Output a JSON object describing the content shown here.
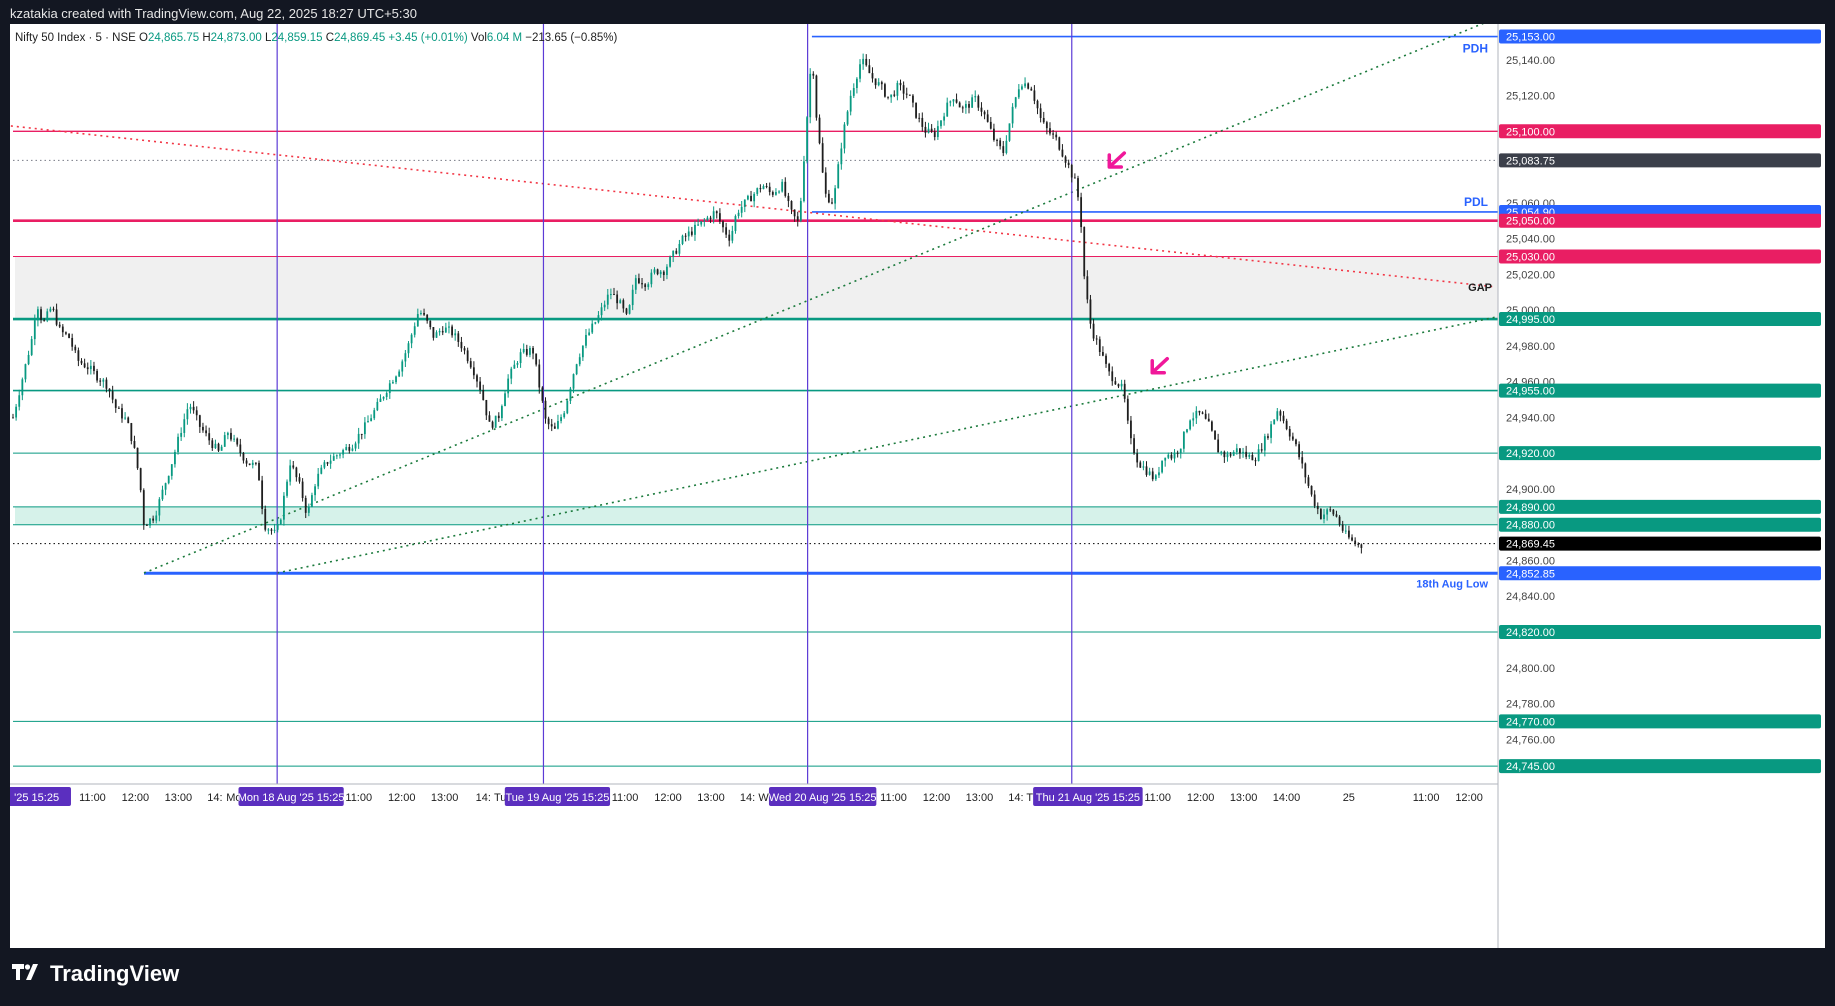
{
  "header": {
    "creator_line": "kzatakia created with TradingView.com, Aug 22, 2025 18:27 UTC+5:30"
  },
  "legend": {
    "symbol": "Nifty 50 Index · 5 · NSE",
    "o_label": "O",
    "o_value": "24,865.75",
    "h_label": "H",
    "h_value": "24,873.00",
    "l_label": "L",
    "l_value": "24,859.15",
    "c_label": "C",
    "c_value": "24,869.45",
    "change": "+3.45 (+0.01%)",
    "vol_label": "Vol",
    "vol_value": "6.04 M",
    "session_change": "−213.65 (−0.85%)"
  },
  "footer": {
    "brand": "TradingView",
    "logo_icon": "tradingview-logo-icon"
  },
  "chart_data": {
    "type": "candlestick",
    "symbol": "Nifty 50 Index",
    "interval": "5",
    "exchange": "NSE",
    "currency": "INR",
    "ylim": [
      24735,
      25160
    ],
    "y_ticks": [
      "25,140.00",
      "25,120.00",
      "25,060.00",
      "25,040.00",
      "25,020.00",
      "25,000.00",
      "24,980.00",
      "24,960.00",
      "24,940.00",
      "24,900.00",
      "24,860.00",
      "24,840.00",
      "24,800.00",
      "24,780.00",
      "24,760.00"
    ],
    "x_tick_labels": [
      {
        "label": "'25",
        "x": 0.15
      },
      {
        "label": "15:25",
        "x": 1.0
      },
      {
        "label": "11:00",
        "x": 1.85
      },
      {
        "label": "12:00",
        "x": 2.85
      },
      {
        "label": "13:00",
        "x": 3.85
      },
      {
        "label": "14:",
        "x": 4.7
      },
      {
        "label": "Mon 18 Aug '25",
        "x": 5.85
      },
      {
        "label": "15:25",
        "x": 7.15
      },
      {
        "label": "11:00",
        "x": 8.05
      },
      {
        "label": "12:00",
        "x": 9.05
      },
      {
        "label": "13:00",
        "x": 10.05
      },
      {
        "label": "14:",
        "x": 10.95
      },
      {
        "label": "Tue 19 Aug '25",
        "x": 12.05
      },
      {
        "label": "15:25",
        "x": 13.35
      },
      {
        "label": "11:00",
        "x": 14.25
      },
      {
        "label": "12:00",
        "x": 15.25
      },
      {
        "label": "13:00",
        "x": 16.25
      },
      {
        "label": "14:",
        "x": 17.1
      },
      {
        "label": "Wed 20 Aug '25",
        "x": 18.25
      },
      {
        "label": "15:25",
        "x": 19.55
      },
      {
        "label": "11:00",
        "x": 20.5
      },
      {
        "label": "12:00",
        "x": 21.5
      },
      {
        "label": "13:00",
        "x": 22.5
      },
      {
        "label": "14:",
        "x": 23.35
      },
      {
        "label": "Thu 21 Aug '25",
        "x": 24.45
      },
      {
        "label": "15:25",
        "x": 25.75
      },
      {
        "label": "11:00",
        "x": 26.65
      },
      {
        "label": "12:00",
        "x": 27.65
      },
      {
        "label": "13:00",
        "x": 28.65
      },
      {
        "label": "14:00",
        "x": 29.65
      },
      {
        "label": "25",
        "x": 31.1
      },
      {
        "label": "11:00",
        "x": 32.9
      },
      {
        "label": "12:00",
        "x": 33.9
      }
    ],
    "highlighted_x_labels": [
      "'25  15:25",
      "Mon 18 Aug '25   15:25",
      "Tue 19 Aug '25   15:25",
      "Wed 20 Aug '25   15:25",
      "Thu 21 Aug '25   15:25"
    ],
    "x_domain": [
      0,
      34.55
    ],
    "session_breaks_x": [
      6.15,
      12.35,
      18.5,
      24.65
    ],
    "price_path": [
      [
        0.0,
        24940
      ],
      [
        0.2,
        24960
      ],
      [
        0.45,
        24985
      ],
      [
        0.55,
        25005
      ],
      [
        0.7,
        24992
      ],
      [
        0.9,
        25002
      ],
      [
        1.1,
        24988
      ],
      [
        1.3,
        24985
      ],
      [
        1.5,
        24972
      ],
      [
        1.75,
        24968
      ],
      [
        2.0,
        24962
      ],
      [
        2.2,
        24958
      ],
      [
        2.4,
        24945
      ],
      [
        2.65,
        24938
      ],
      [
        2.8,
        24925
      ],
      [
        2.95,
        24905
      ],
      [
        3.05,
        24880
      ],
      [
        3.3,
        24885
      ],
      [
        3.5,
        24900
      ],
      [
        3.7,
        24915
      ],
      [
        3.9,
        24932
      ],
      [
        4.1,
        24948
      ],
      [
        4.35,
        24935
      ],
      [
        4.55,
        24928
      ],
      [
        4.8,
        24920
      ],
      [
        5.0,
        24932
      ],
      [
        5.25,
        24922
      ],
      [
        5.45,
        24915
      ],
      [
        5.7,
        24912
      ],
      [
        5.85,
        24880
      ],
      [
        6.1,
        24875
      ],
      [
        6.2,
        24880
      ],
      [
        6.45,
        24915
      ],
      [
        6.7,
        24900
      ],
      [
        6.85,
        24885
      ],
      [
        7.05,
        24905
      ],
      [
        7.3,
        24915
      ],
      [
        7.6,
        24920
      ],
      [
        7.9,
        24925
      ],
      [
        8.2,
        24935
      ],
      [
        8.45,
        24945
      ],
      [
        8.75,
        24958
      ],
      [
        9.0,
        24968
      ],
      [
        9.2,
        24980
      ],
      [
        9.45,
        25000
      ],
      [
        9.6,
        24995
      ],
      [
        9.8,
        24985
      ],
      [
        10.0,
        24990
      ],
      [
        10.2,
        24988
      ],
      [
        10.45,
        24980
      ],
      [
        10.7,
        24968
      ],
      [
        10.9,
        24955
      ],
      [
        11.1,
        24935
      ],
      [
        11.3,
        24940
      ],
      [
        11.5,
        24960
      ],
      [
        11.8,
        24975
      ],
      [
        12.1,
        24978
      ],
      [
        12.4,
        24938
      ],
      [
        12.6,
        24932
      ],
      [
        12.85,
        24945
      ],
      [
        13.1,
        24970
      ],
      [
        13.35,
        24985
      ],
      [
        13.6,
        24995
      ],
      [
        13.9,
        25010
      ],
      [
        14.1,
        25005
      ],
      [
        14.3,
        24995
      ],
      [
        14.5,
        25018
      ],
      [
        14.75,
        25015
      ],
      [
        14.95,
        25022
      ],
      [
        15.15,
        25022
      ],
      [
        15.35,
        25030
      ],
      [
        15.6,
        25040
      ],
      [
        15.85,
        25045
      ],
      [
        16.1,
        25050
      ],
      [
        16.35,
        25055
      ],
      [
        16.55,
        25045
      ],
      [
        16.7,
        25040
      ],
      [
        16.85,
        25055
      ],
      [
        17.05,
        25060
      ],
      [
        17.25,
        25065
      ],
      [
        17.45,
        25070
      ],
      [
        17.65,
        25065
      ],
      [
        17.9,
        25070
      ],
      [
        18.1,
        25055
      ],
      [
        18.3,
        25048
      ],
      [
        18.6,
        25145
      ],
      [
        18.7,
        25110
      ],
      [
        18.9,
        25065
      ],
      [
        19.1,
        25060
      ],
      [
        19.3,
        25095
      ],
      [
        19.5,
        25120
      ],
      [
        19.75,
        25140
      ],
      [
        20.0,
        25130
      ],
      [
        20.2,
        25125
      ],
      [
        20.4,
        25118
      ],
      [
        20.6,
        25125
      ],
      [
        20.85,
        25120
      ],
      [
        21.05,
        25108
      ],
      [
        21.25,
        25100
      ],
      [
        21.45,
        25098
      ],
      [
        21.7,
        25112
      ],
      [
        21.9,
        25120
      ],
      [
        22.1,
        25112
      ],
      [
        22.4,
        25118
      ],
      [
        22.6,
        25110
      ],
      [
        22.85,
        25095
      ],
      [
        23.05,
        25088
      ],
      [
        23.25,
        25110
      ],
      [
        23.45,
        25128
      ],
      [
        23.7,
        25125
      ],
      [
        23.95,
        25105
      ],
      [
        24.1,
        25100
      ],
      [
        24.3,
        25095
      ],
      [
        24.55,
        25082
      ],
      [
        24.75,
        25070
      ],
      [
        24.85,
        25055
      ],
      [
        24.95,
        25015
      ],
      [
        25.1,
        24990
      ],
      [
        25.3,
        24978
      ],
      [
        25.5,
        24965
      ],
      [
        25.7,
        24960
      ],
      [
        25.85,
        24955
      ],
      [
        26.0,
        24928
      ],
      [
        26.2,
        24915
      ],
      [
        26.4,
        24910
      ],
      [
        26.6,
        24905
      ],
      [
        26.8,
        24920
      ],
      [
        27.0,
        24918
      ],
      [
        27.2,
        24925
      ],
      [
        27.4,
        24940
      ],
      [
        27.65,
        24942
      ],
      [
        27.85,
        24935
      ],
      [
        28.05,
        24922
      ],
      [
        28.25,
        24918
      ],
      [
        28.5,
        24922
      ],
      [
        28.75,
        24918
      ],
      [
        28.95,
        24918
      ],
      [
        29.2,
        24930
      ],
      [
        29.45,
        24945
      ],
      [
        29.65,
        24935
      ],
      [
        29.85,
        24925
      ],
      [
        30.05,
        24910
      ],
      [
        30.25,
        24895
      ],
      [
        30.45,
        24885
      ],
      [
        30.65,
        24888
      ],
      [
        30.8,
        24885
      ],
      [
        31.0,
        24875
      ],
      [
        31.2,
        24870
      ],
      [
        31.4,
        24868
      ]
    ],
    "horizontal_levels": [
      {
        "price": 25153.0,
        "label": "25,153.00",
        "color": "#2962ff",
        "style": "solid",
        "width": 1.6,
        "x_start": 18.6,
        "tag": "PDH"
      },
      {
        "price": 25100.0,
        "label": "25,100.00",
        "color": "#e91e63",
        "style": "solid",
        "width": 1.4,
        "x_start": 0
      },
      {
        "price": 25083.75,
        "label": "25,083.75",
        "color": "#787b86",
        "style": "dotted",
        "width": 1,
        "x_start": 0
      },
      {
        "price": 25054.9,
        "label": "25,054.90",
        "color": "#2962ff",
        "style": "solid",
        "width": 1.6,
        "x_start": 18.6,
        "tag": "PDL"
      },
      {
        "price": 25050.0,
        "label": "25,050.00",
        "color": "#e91e63",
        "style": "solid",
        "width": 2.6,
        "x_start": 0
      },
      {
        "price": 25030.0,
        "label": "25,030.00",
        "color": "#e91e63",
        "style": "solid",
        "width": 1,
        "x_start": 0
      },
      {
        "price": 24995.0,
        "label": "24,995.00",
        "color": "#089981",
        "style": "solid",
        "width": 2.6,
        "x_start": 0
      },
      {
        "price": 24955.0,
        "label": "24,955.00",
        "color": "#089981",
        "style": "solid",
        "width": 1.6,
        "x_start": 0
      },
      {
        "price": 24920.0,
        "label": "24,920.00",
        "color": "#089981",
        "style": "solid",
        "width": 1,
        "x_start": 0
      },
      {
        "price": 24890.0,
        "label": "24,890.00",
        "color": "#089981",
        "style": "solid",
        "width": 1,
        "x_start": 0
      },
      {
        "price": 24880.0,
        "label": "24,880.00",
        "color": "#089981",
        "style": "solid",
        "width": 1,
        "x_start": 0
      },
      {
        "price": 24869.45,
        "label": "24,869.45",
        "color": "#000000",
        "style": "dotted",
        "width": 1,
        "x_start": 0
      },
      {
        "price": 24852.85,
        "label": "24,852.85",
        "color": "#2962ff",
        "style": "solid",
        "width": 3,
        "x_start": 3.05,
        "tag": "18th Aug Low"
      },
      {
        "price": 24820.0,
        "label": "24,820.00",
        "color": "#089981",
        "style": "solid",
        "width": 1,
        "x_start": 0
      },
      {
        "price": 24770.0,
        "label": "24,770.00",
        "color": "#089981",
        "style": "solid",
        "width": 1,
        "x_start": 0
      },
      {
        "price": 24745.0,
        "label": "24,745.00",
        "color": "#089981",
        "style": "solid",
        "width": 1,
        "x_start": 0
      }
    ],
    "zones": [
      {
        "from": 25030,
        "to": 24995,
        "color": "#f0f0f0",
        "tag": "GAP"
      },
      {
        "from": 24890,
        "to": 24880,
        "color": "#d6f2ea"
      }
    ],
    "trendlines": [
      {
        "from": [
          -0.05,
          25103
        ],
        "to": [
          34.5,
          25013
        ],
        "color": "#f23645",
        "style": "dotted"
      },
      {
        "from": [
          3.05,
          24853
        ],
        "to": [
          34.5,
          25163
        ],
        "color": "#1b7a3c",
        "style": "dotted"
      },
      {
        "from": [
          6.15,
          24853
        ],
        "to": [
          34.5,
          24996
        ],
        "color": "#1b7a3c",
        "style": "dotted"
      }
    ],
    "arrows": [
      {
        "x": 25.5,
        "price": 25080,
        "color": "#f0189a"
      },
      {
        "x": 26.5,
        "price": 24965,
        "color": "#f0189a"
      }
    ],
    "annotations": [
      "PDH",
      "PDL",
      "GAP",
      "18th Aug Low"
    ],
    "last_price": "24,869.45",
    "grid": false
  }
}
